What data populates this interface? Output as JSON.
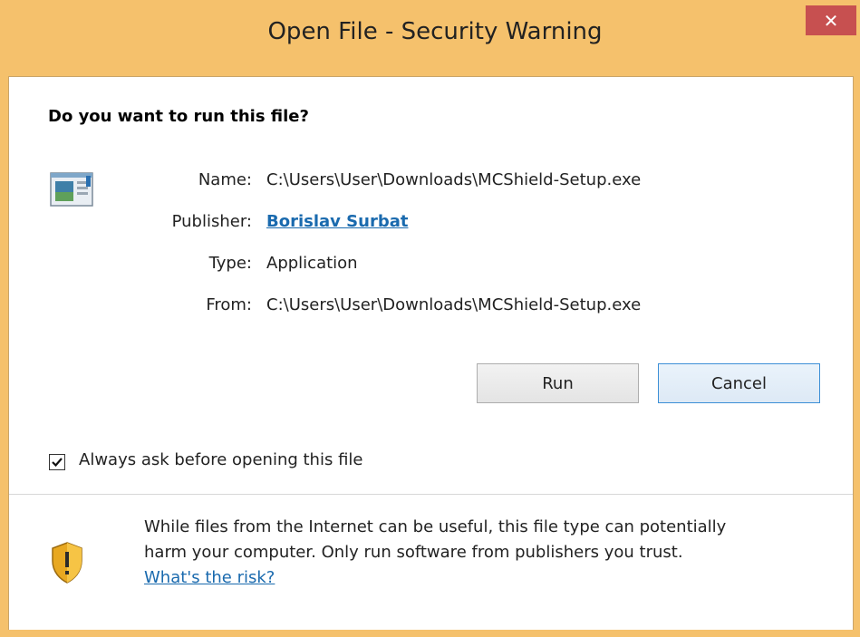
{
  "window": {
    "title": "Open File - Security Warning",
    "close_glyph": "✕"
  },
  "dialog": {
    "question": "Do you want to run this file?",
    "icon": "application-icon",
    "fields": {
      "name_label": "Name:",
      "name_value": "C:\\Users\\User\\Downloads\\MCShield-Setup.exe",
      "publisher_label": "Publisher:",
      "publisher_value": "Borislav Surbat",
      "type_label": "Type:",
      "type_value": "Application",
      "from_label": "From:",
      "from_value": "C:\\Users\\User\\Downloads\\MCShield-Setup.exe"
    },
    "buttons": {
      "run_label": "Run",
      "cancel_label": "Cancel"
    },
    "checkbox": {
      "label": "Always ask before opening this file",
      "checked": true
    }
  },
  "warning": {
    "icon": "shield-warning-icon",
    "text_line1": "While files from the Internet can be useful, this file type can potentially",
    "text_line2": "harm your computer. Only run software from publishers you trust.",
    "risk_link": "What's the risk?"
  },
  "colors": {
    "titlebar": "#f5c16c",
    "close_button": "#c75050",
    "link": "#1a6aae"
  }
}
